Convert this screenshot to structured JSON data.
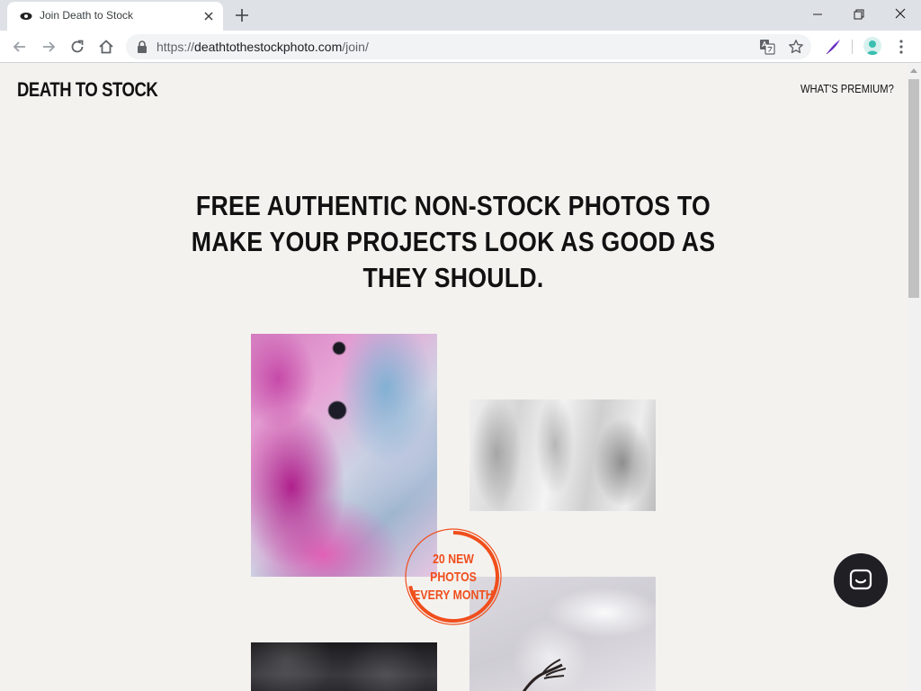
{
  "browser": {
    "tab": {
      "title": "Join Death to Stock",
      "favicon": "eye-icon"
    },
    "url": {
      "scheme": "https://",
      "host": "deathtothestockphoto.com",
      "path": "/join/"
    },
    "icons": [
      "back-arrow-icon",
      "forward-arrow-icon",
      "reload-icon",
      "home-icon",
      "lock-icon",
      "translate-icon",
      "star-icon",
      "feather-extension-icon",
      "profile-avatar-icon",
      "menu-dots-icon"
    ]
  },
  "site": {
    "logo": "DEATH TO STOCK",
    "nav_link": "WHAT'S PREMIUM?",
    "headline": "FREE AUTHENTIC NON-STOCK PHOTOS TO MAKE YOUR PROJECTS LOOK AS GOOD AS THEY SHOULD.",
    "badge": "20 NEW PHOTOS EVERY MONTH",
    "chat_icon": "chat-bubble-icon"
  },
  "colors": {
    "page_background": "#f4f2ef",
    "badge_accent": "#f04e1c",
    "chat_button": "#1f1f24"
  }
}
